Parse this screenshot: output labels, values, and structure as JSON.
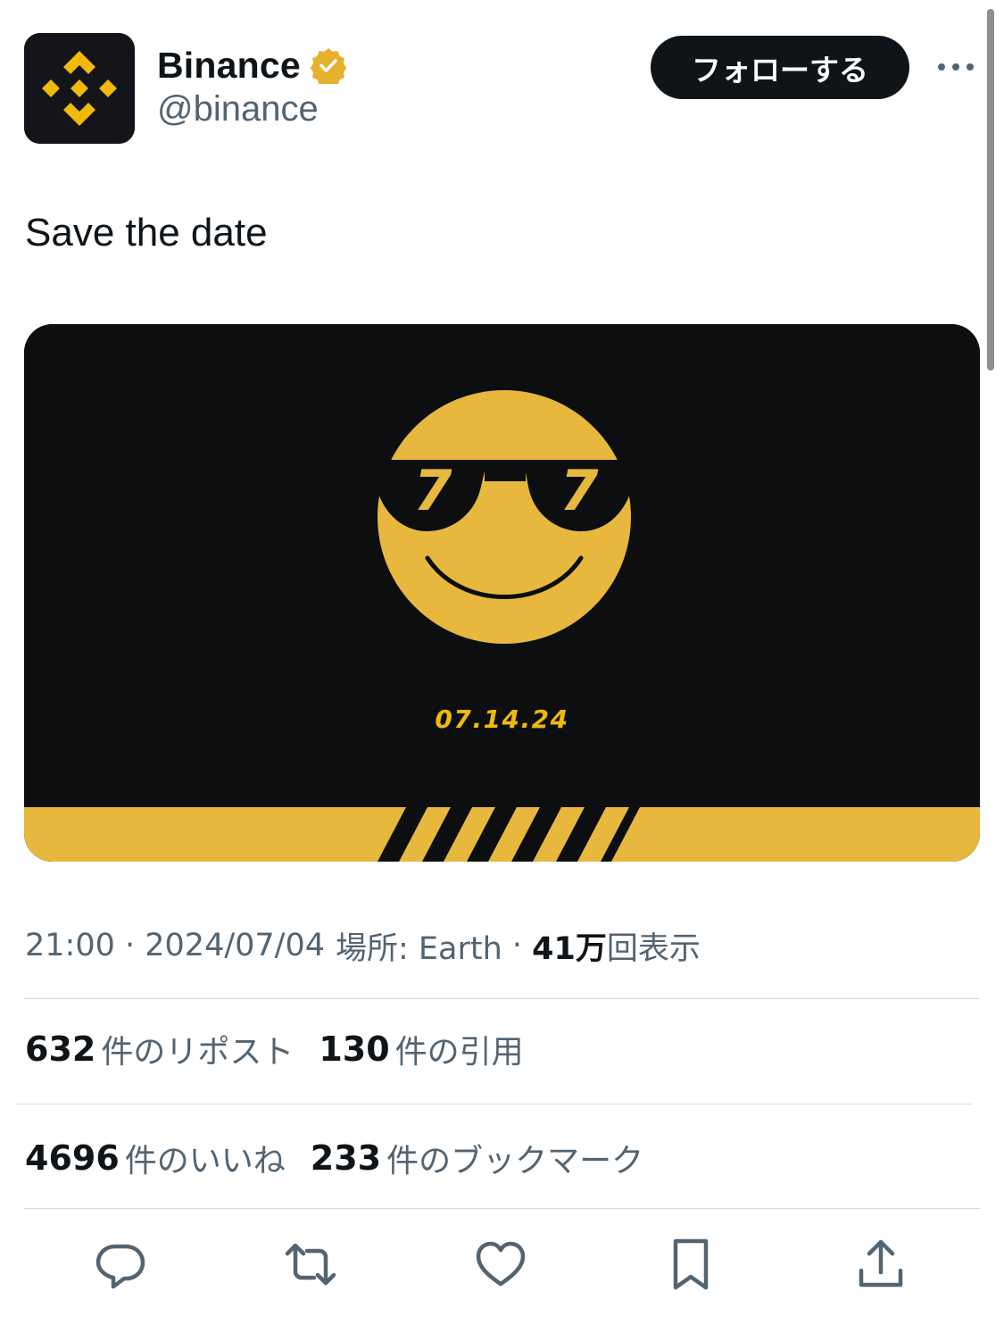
{
  "author": {
    "display_name": "Binance",
    "handle": "@binance",
    "verified_icon": "verified-gold-badge-icon",
    "avatar_icon": "binance-logo-icon",
    "brand_color": "#F0B90B"
  },
  "header": {
    "follow_label": "フォローする",
    "more_icon": "more-horizontal-icon"
  },
  "tweet": {
    "text": "Save the date",
    "media": {
      "description_icon": "cool-smiley-sunglasses-icon",
      "date_text": "07.14.24",
      "lens_left": "7",
      "lens_right": "7",
      "background_color": "#0C0E10",
      "accent_color": "#F0B90B"
    }
  },
  "meta": {
    "time": "21:00",
    "separator": " · ",
    "date": "2024/07/04",
    "location_label": "場所: Earth",
    "views_count": "41万",
    "views_label": "回表示"
  },
  "stats": {
    "reposts_count": "632",
    "reposts_label": "件のリポスト",
    "quotes_count": "130",
    "quotes_label": "件の引用",
    "likes_count": "4696",
    "likes_label": "件のいいね",
    "bookmarks_count": "233",
    "bookmarks_label": "件のブックマーク"
  },
  "actions": {
    "reply_icon": "reply-icon",
    "repost_icon": "repost-icon",
    "like_icon": "heart-icon",
    "bookmark_icon": "bookmark-icon",
    "share_icon": "share-icon"
  }
}
